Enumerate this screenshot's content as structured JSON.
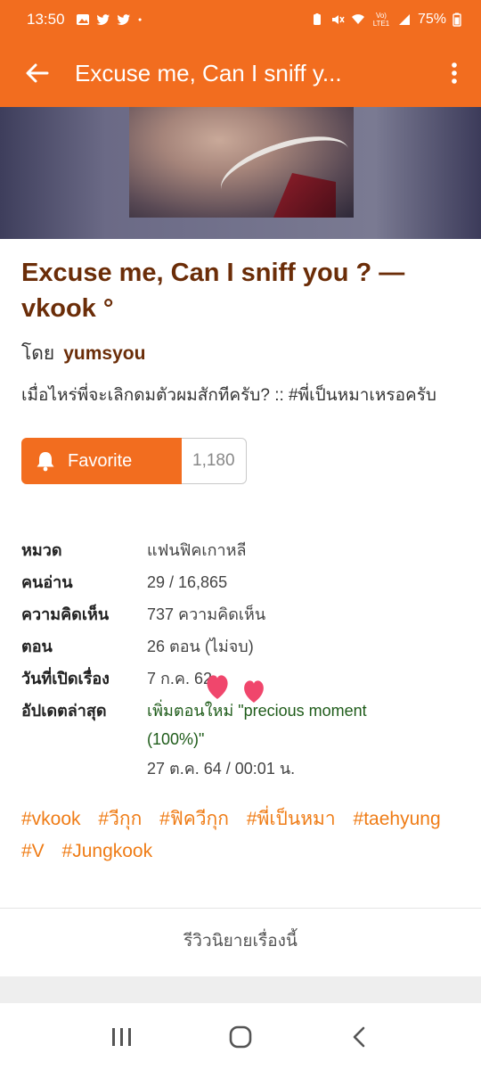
{
  "status": {
    "time": "13:50",
    "battery": "75%",
    "network_label": "Vo) LTE1"
  },
  "app_bar": {
    "title": "Excuse me, Can I sniff y..."
  },
  "story": {
    "title": "Excuse me, Can I sniff you ? — vkook °",
    "by_label": "โดย",
    "author": "yumsyou",
    "description": "เมื่อไหร่พี่จะเลิกดมตัวผมสักทีครับ? :: #พี่เป็นหมาเหรอครับ"
  },
  "favorite": {
    "label": "Favorite",
    "count": "1,180"
  },
  "info": [
    {
      "key": "หมวด",
      "value": "แฟนฟิคเกาหลี"
    },
    {
      "key": "คนอ่าน",
      "value": "29 / 16,865"
    },
    {
      "key": "ความคิดเห็น",
      "value": "737 ความคิดเห็น"
    },
    {
      "key": "ตอน",
      "value": "26 ตอน (ไม่จบ)"
    },
    {
      "key": "วันที่เปิดเรื่อง",
      "value": "7 ก.ค. 62"
    }
  ],
  "update": {
    "key": "อัปเดตล่าสุด",
    "line1": "เพิ่มตอนใหม่ \"precious moment",
    "line2": "(100%)\"",
    "date": "27 ต.ค. 64 / 00:01 น."
  },
  "tags": [
    "#vkook",
    "#วีกุก",
    "#ฟิควีกุก",
    "#พี่เป็นหมา",
    "#taehyung",
    "#V",
    "#Jungkook"
  ],
  "review_link": "รีวิวนิยายเรื่องนี้",
  "colors": {
    "accent": "#f26d1f",
    "title_brown": "#6b2d08",
    "tag_orange": "#ef7c16",
    "update_green": "#1f5c1a"
  }
}
